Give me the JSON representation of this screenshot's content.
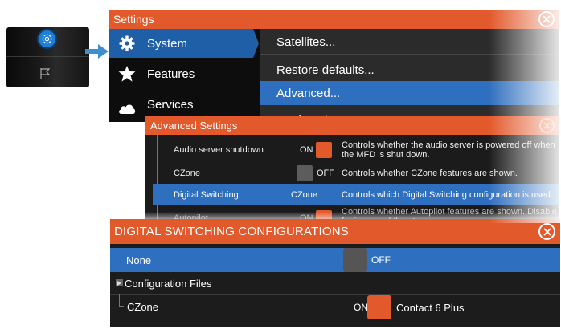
{
  "home": {
    "icons": [
      "settings-gear-icon",
      "flag-icon"
    ]
  },
  "settings": {
    "title": "Settings",
    "nav": [
      {
        "label": "System",
        "icon": "gear-icon",
        "selected": true
      },
      {
        "label": "Features",
        "icon": "star-icon",
        "selected": false
      },
      {
        "label": "Services",
        "icon": "cloud-icon",
        "selected": false
      }
    ],
    "options": [
      {
        "label": "Satellites...",
        "selected": false
      },
      {
        "label": "Restore defaults...",
        "selected": false
      },
      {
        "label": "Advanced...",
        "selected": true
      },
      {
        "label": "Registration",
        "selected": false
      }
    ]
  },
  "advanced": {
    "title": "Advanced Settings",
    "rows": [
      {
        "label": "Audio server shutdown",
        "state": "ON",
        "description": "Controls whether the audio server is powered off when the MFD is shut down."
      },
      {
        "label": "CZone",
        "state": "OFF",
        "description": "Controls whether CZone features are shown."
      },
      {
        "label": "Digital Switching",
        "value": "CZone",
        "description": "Controls which Digital Switching configuration is used."
      },
      {
        "label": "Autopilot",
        "state": "ON",
        "description": "Controls whether Autopilot features are shown. Disable for improved thruster..."
      }
    ]
  },
  "digital": {
    "title": "DIGITAL SWITCHING CONFIGURATIONS",
    "rows": [
      {
        "label": "None",
        "state": "OFF",
        "selected": true
      },
      {
        "label": "Configuration Files",
        "expandable": true
      },
      {
        "label": "CZone",
        "state": "ON",
        "detail": "Contact 6 Plus"
      }
    ]
  },
  "colors": {
    "accent": "#e2592b",
    "selection": "#2f6fbf",
    "panel": "#1c1c1c"
  }
}
